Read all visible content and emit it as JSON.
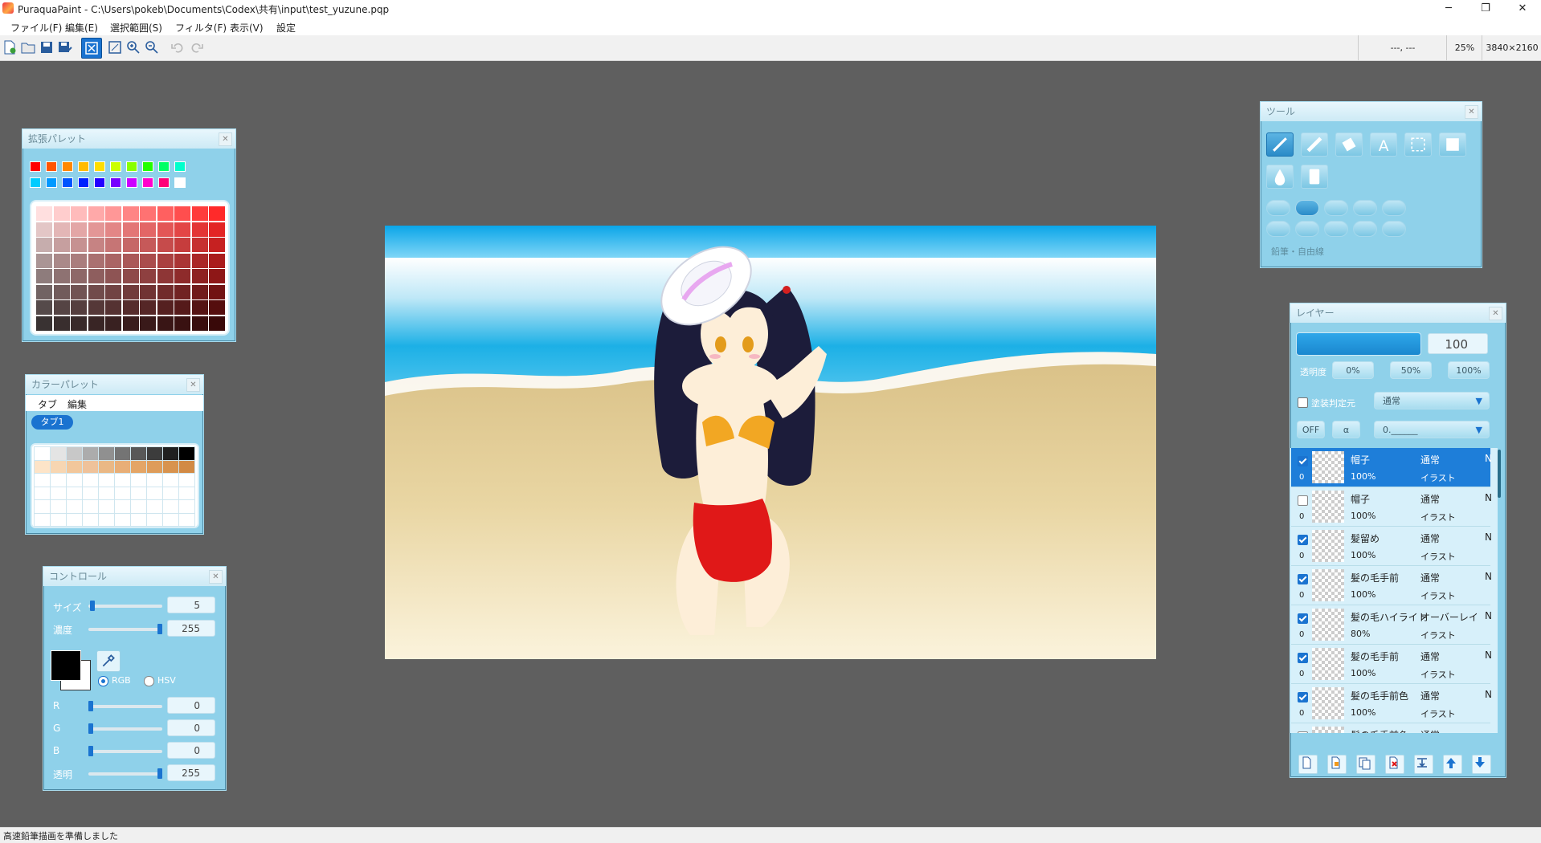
{
  "window": {
    "title": "PuraquaPaint - C:\\Users\\pokeb\\Documents\\Codex\\共有\\input\\test_yuzune.pqp",
    "minimize": "─",
    "maximize": "❐",
    "close": "✕"
  },
  "menu": [
    "ファイル(F)",
    "編集(E)",
    "選択範囲(S)",
    "フィルタ(F)",
    "表示(V)",
    "設定"
  ],
  "status_top": {
    "coords": "---, ---",
    "zoom": "25%",
    "size": "3840×2160"
  },
  "status_bottom": "高速鉛筆描画を準備しました",
  "ext_palette": {
    "title": "拡張パレット",
    "row1": [
      "#ff0000",
      "#ff5500",
      "#ff8800",
      "#ffbb00",
      "#ffdd00",
      "#ccff00",
      "#88ff00",
      "#22ff00",
      "#00ff66",
      "#00ffcc"
    ],
    "row2": [
      "#00ccff",
      "#0099ff",
      "#0055ff",
      "#0022ff",
      "#2200ff",
      "#7700ff",
      "#cc00ff",
      "#ff00cc",
      "#ff0077",
      "#ffffff"
    ],
    "grid_hue": "#ff2a2a"
  },
  "color_palette": {
    "title": "カラーパレット",
    "tab_menu": "タブ",
    "edit_menu": "編集",
    "active_tab": "タブ1",
    "row1": [
      "#ffffff",
      "#e4e4e4",
      "#c8c8c8",
      "#acacac",
      "#909090",
      "#747474",
      "#585858",
      "#3c3c3c",
      "#202020",
      "#000000"
    ],
    "row2": [
      "#fde4c8",
      "#f7d6b2",
      "#f2c79b",
      "#efc29a",
      "#eab885",
      "#e8ae77",
      "#e4a566",
      "#de9c5a",
      "#d8934e",
      "#d28a45"
    ]
  },
  "control": {
    "title": "コントロール",
    "size_label": "サイズ",
    "size": "5",
    "density_label": "濃度",
    "density": "255",
    "rgb": "RGB",
    "hsv": "HSV",
    "r_label": "R",
    "r": "0",
    "g_label": "G",
    "g": "0",
    "b_label": "B",
    "b": "0",
    "alpha_label": "透明",
    "alpha": "255"
  },
  "tools": {
    "title": "ツール",
    "current": "鉛筆・自由線"
  },
  "layers": {
    "title": "レイヤー",
    "opacity_value": "100",
    "opacity_label": "透明度",
    "presets": [
      "0%",
      "50%",
      "100%"
    ],
    "clip_label": "塗装判定元",
    "blend": "通常",
    "off": "OFF",
    "alpha": "α",
    "mask": "0.______",
    "items": [
      {
        "index": "0",
        "name": "帽子",
        "opacity": "100%",
        "blend": "通常",
        "type": "イラスト",
        "n": "N",
        "checked": true,
        "selected": true
      },
      {
        "index": "0",
        "name": "帽子",
        "opacity": "100%",
        "blend": "通常",
        "type": "イラスト",
        "n": "N",
        "checked": false,
        "selected": false
      },
      {
        "index": "0",
        "name": "髪留め",
        "opacity": "100%",
        "blend": "通常",
        "type": "イラスト",
        "n": "N",
        "checked": true,
        "selected": false
      },
      {
        "index": "0",
        "name": "髪の毛手前",
        "opacity": "100%",
        "blend": "通常",
        "type": "イラスト",
        "n": "N",
        "checked": true,
        "selected": false
      },
      {
        "index": "0",
        "name": "髪の毛ハイライト",
        "opacity": "80%",
        "blend": "オーバーレイ",
        "type": "イラスト",
        "n": "N",
        "checked": true,
        "selected": false
      },
      {
        "index": "0",
        "name": "髪の毛手前",
        "opacity": "100%",
        "blend": "通常",
        "type": "イラスト",
        "n": "N",
        "checked": true,
        "selected": false
      },
      {
        "index": "0",
        "name": "髪の毛手前色",
        "opacity": "100%",
        "blend": "通常",
        "type": "イラスト",
        "n": "N",
        "checked": true,
        "selected": false
      },
      {
        "index": "",
        "name": "髪の毛手前色",
        "opacity": "",
        "blend": "通常",
        "type": "",
        "n": "",
        "checked": false,
        "selected": false
      }
    ]
  }
}
